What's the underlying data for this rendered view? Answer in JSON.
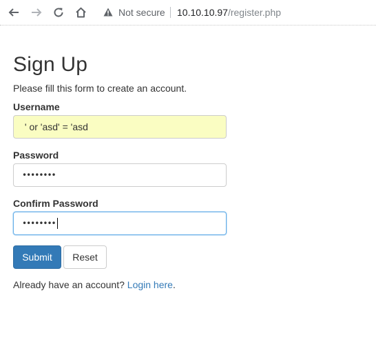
{
  "browser": {
    "security_label": "Not secure",
    "url_host": "10.10.10.97",
    "url_path": "/register.php"
  },
  "form": {
    "title": "Sign Up",
    "subtitle": "Please fill this form to create an account.",
    "username": {
      "label": "Username",
      "value": " ' or 'asd' = 'asd"
    },
    "password": {
      "label": "Password",
      "masked_value": "••••••••"
    },
    "confirm_password": {
      "label": "Confirm Password",
      "masked_value": "••••••••"
    },
    "submit_label": "Submit",
    "reset_label": "Reset",
    "login_prompt": "Already have an account? ",
    "login_link": "Login here",
    "login_suffix": "."
  },
  "colors": {
    "primary": "#337ab7",
    "autofill": "#fafdc2",
    "focus_border": "#66afe9"
  },
  "icons": [
    "back-arrow-icon",
    "forward-arrow-icon",
    "reload-icon",
    "home-icon",
    "warning-icon"
  ]
}
